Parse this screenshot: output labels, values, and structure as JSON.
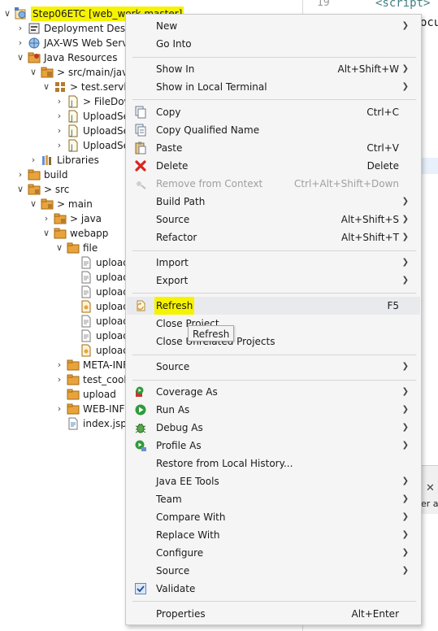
{
  "project_tree": {
    "project_label": "Step06ETC [web_work master]",
    "items": [
      {
        "label": "Deployment Descri"
      },
      {
        "label": "JAX-WS Web Servi"
      },
      {
        "label": "Java Resources"
      },
      {
        "label": "src/main/java"
      },
      {
        "label": "test.servlet"
      },
      {
        "label": "FileDow"
      },
      {
        "label": "UploadSe"
      },
      {
        "label": "UploadSe"
      },
      {
        "label": "UploadSe"
      },
      {
        "label": "Libraries"
      },
      {
        "label": "build"
      },
      {
        "label": "src"
      },
      {
        "label": "main"
      },
      {
        "label": "java"
      },
      {
        "label": "webapp"
      },
      {
        "label": "file"
      },
      {
        "label": "upload"
      },
      {
        "label": "upload"
      },
      {
        "label": "upload"
      },
      {
        "label": "upload"
      },
      {
        "label": "upload"
      },
      {
        "label": "upload"
      },
      {
        "label": "upload"
      },
      {
        "label": "META-INF"
      },
      {
        "label": "test_cook"
      },
      {
        "label": "upload"
      },
      {
        "label": "WEB-INF"
      },
      {
        "label": "index.jsp"
      }
    ]
  },
  "editor_strip": {
    "line_number": "19",
    "code_line1": "<script>",
    "code_line2": "ocu",
    "panel_text": "er a"
  },
  "context_menu": {
    "items": [
      {
        "label": "New",
        "shortcut": "",
        "submenu": true
      },
      {
        "label": "Go Into",
        "shortcut": "",
        "submenu": false
      },
      {
        "label": "Show In",
        "shortcut": "Alt+Shift+W",
        "submenu": true
      },
      {
        "label": "Show in Local Terminal",
        "shortcut": "",
        "submenu": true
      },
      {
        "label": "Copy",
        "shortcut": "Ctrl+C",
        "submenu": false,
        "icon": "copy-icon"
      },
      {
        "label": "Copy Qualified Name",
        "shortcut": "",
        "submenu": false,
        "icon": "copy-qualified-name-icon"
      },
      {
        "label": "Paste",
        "shortcut": "Ctrl+V",
        "submenu": false,
        "icon": "paste-icon"
      },
      {
        "label": "Delete",
        "shortcut": "Delete",
        "submenu": false,
        "icon": "delete-icon"
      },
      {
        "label": "Remove from Context",
        "shortcut": "Ctrl+Alt+Shift+Down",
        "submenu": false,
        "disabled": true,
        "icon": "remove-from-context-icon"
      },
      {
        "label": "Build Path",
        "shortcut": "",
        "submenu": true
      },
      {
        "label": "Source",
        "shortcut": "Alt+Shift+S",
        "submenu": true
      },
      {
        "label": "Refactor",
        "shortcut": "Alt+Shift+T",
        "submenu": true
      },
      {
        "label": "Import",
        "shortcut": "",
        "submenu": true
      },
      {
        "label": "Export",
        "shortcut": "",
        "submenu": true
      },
      {
        "label": "Refresh",
        "shortcut": "F5",
        "submenu": false,
        "icon": "refresh-icon",
        "highlighted": true
      },
      {
        "label": "Close Project",
        "shortcut": "",
        "submenu": false
      },
      {
        "label": "Close Unrelated Projects",
        "shortcut": "",
        "submenu": false
      },
      {
        "label": "Source",
        "shortcut": "",
        "submenu": true
      },
      {
        "label": "Coverage As",
        "shortcut": "",
        "submenu": true,
        "icon": "coverage-icon"
      },
      {
        "label": "Run As",
        "shortcut": "",
        "submenu": true,
        "icon": "run-icon"
      },
      {
        "label": "Debug As",
        "shortcut": "",
        "submenu": true,
        "icon": "debug-icon"
      },
      {
        "label": "Profile As",
        "shortcut": "",
        "submenu": true,
        "icon": "profile-icon"
      },
      {
        "label": "Restore from Local History...",
        "shortcut": "",
        "submenu": false
      },
      {
        "label": "Java EE Tools",
        "shortcut": "",
        "submenu": true
      },
      {
        "label": "Team",
        "shortcut": "",
        "submenu": true
      },
      {
        "label": "Compare With",
        "shortcut": "",
        "submenu": true
      },
      {
        "label": "Replace With",
        "shortcut": "",
        "submenu": true
      },
      {
        "label": "Configure",
        "shortcut": "",
        "submenu": true
      },
      {
        "label": "Source",
        "shortcut": "",
        "submenu": true
      },
      {
        "label": "Validate",
        "shortcut": "",
        "submenu": false,
        "icon": "checkbox-checked-icon"
      },
      {
        "label": "Properties",
        "shortcut": "Alt+Enter",
        "submenu": false
      }
    ]
  },
  "tooltip": {
    "text": "Refresh"
  },
  "colors": {
    "highlight": "#f6f300",
    "menu_background": "#f5f5f5",
    "folder": "#e8a33c",
    "delete_red": "#d9251d",
    "run_green": "#2e9b3c"
  }
}
